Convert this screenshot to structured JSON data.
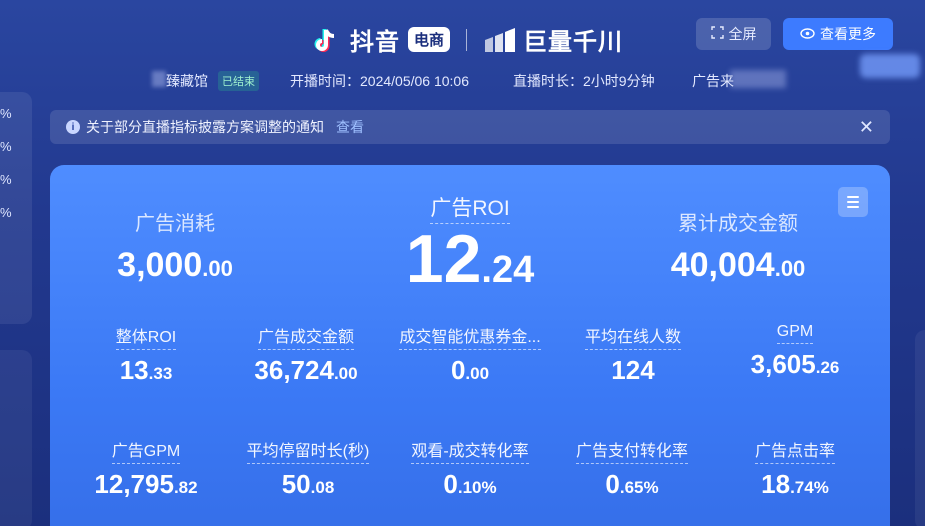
{
  "left_edge_values": [
    "%",
    "%",
    "%",
    "%"
  ],
  "header": {
    "brand_name": "抖音",
    "ecom_tag": "电商",
    "qianchuan_name": "巨量千川",
    "fullscreen_label": "全屏",
    "more_label": "查看更多"
  },
  "info": {
    "room_name": "臻藏馆",
    "status_badge": "已结束",
    "start_time": "开播时间：2024/05/06 10:06",
    "duration": "直播时长：2小时9分钟",
    "ad_source": "广告来"
  },
  "notice": {
    "text": "关于部分直播指标披露方案调整的通知",
    "link": "查看"
  },
  "metrics": {
    "ad_spend": {
      "label": "广告消耗",
      "int": "3,000",
      "dec": ".00"
    },
    "ad_roi": {
      "label": "广告ROI",
      "int": "12",
      "dec": ".24"
    },
    "total_gmv": {
      "label": "累计成交金额",
      "int": "40,004",
      "dec": ".00"
    },
    "overall_roi": {
      "label": "整体ROI",
      "int": "13",
      "dec": ".33"
    },
    "ad_gmv": {
      "label": "广告成交金额",
      "int": "36,724",
      "dec": ".00"
    },
    "coupon": {
      "label": "成交智能优惠券金...",
      "int": "0",
      "dec": ".00"
    },
    "avg_online": {
      "label": "平均在线人数",
      "int": "124",
      "dec": ""
    },
    "gpm": {
      "label": "GPM",
      "int": "3,605",
      "dec": ".26"
    },
    "ad_gpm": {
      "label": "广告GPM",
      "int": "12,795",
      "dec": ".82"
    },
    "avg_stay": {
      "label": "平均停留时长(秒)",
      "int": "50",
      "dec": ".08"
    },
    "view_conv": {
      "label": "观看-成交转化率",
      "int": "0",
      "dec": ".10%"
    },
    "ad_pay_conv": {
      "label": "广告支付转化率",
      "int": "0",
      "dec": ".65%"
    },
    "ad_ctr": {
      "label": "广告点击率",
      "int": "18",
      "dec": ".74%"
    }
  }
}
